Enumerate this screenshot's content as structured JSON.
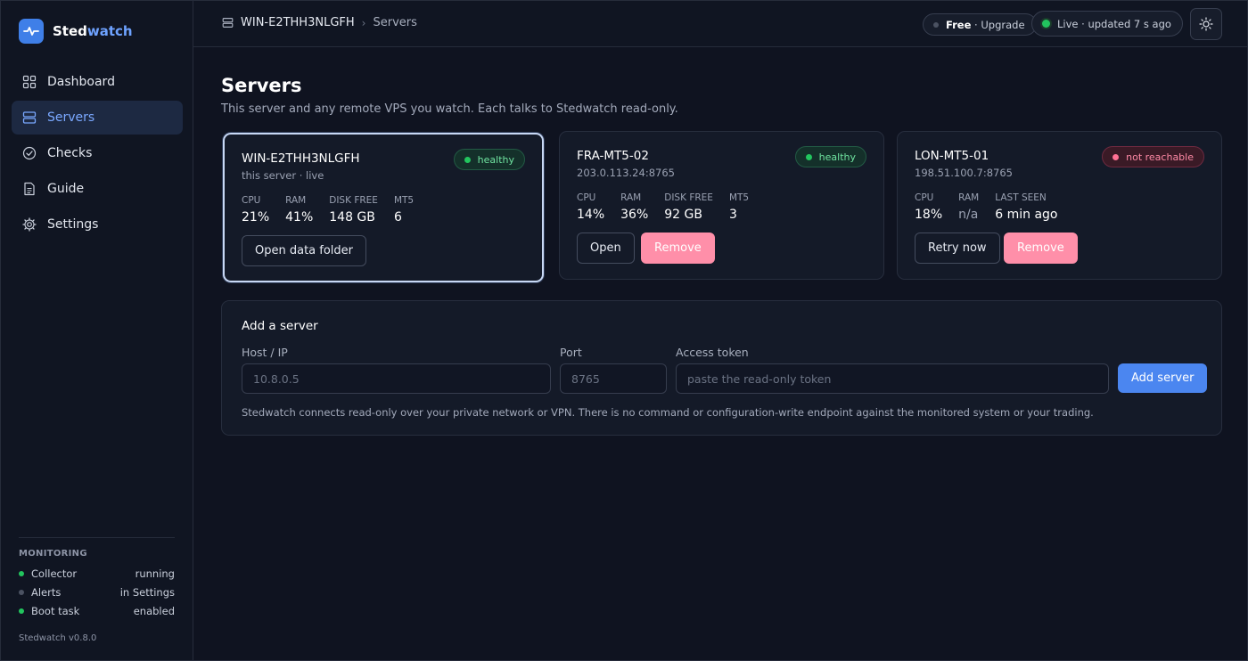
{
  "brand": {
    "name_part1": "Sted",
    "name_part2": "watch",
    "logo_icon": "pulse-icon"
  },
  "sidebar": {
    "nav": [
      {
        "label": "Dashboard",
        "icon": "grid-icon",
        "active": false
      },
      {
        "label": "Servers",
        "icon": "server-icon",
        "active": true
      },
      {
        "label": "Checks",
        "icon": "check-circle-icon",
        "active": false
      },
      {
        "label": "Guide",
        "icon": "document-icon",
        "active": false
      },
      {
        "label": "Settings",
        "icon": "gear-icon",
        "active": false
      }
    ],
    "monitoring": {
      "title": "MONITORING",
      "rows": [
        {
          "label": "Collector",
          "value": "running",
          "status": "green"
        },
        {
          "label": "Alerts",
          "value": "in Settings",
          "status": "gray"
        },
        {
          "label": "Boot task",
          "value": "enabled",
          "status": "green"
        }
      ]
    },
    "version": "Stedwatch v0.8.0"
  },
  "topbar": {
    "breadcrumb": {
      "host": "WIN-E2THH3NLGFH",
      "separator": "›",
      "page": "Servers"
    },
    "plan": {
      "tier": "Free",
      "separator": " · ",
      "action": "Upgrade"
    },
    "live": {
      "text": "Live · updated 7 s ago"
    },
    "theme_icon": "sun-icon"
  },
  "main": {
    "title": "Servers",
    "subtitle": "This server and any remote VPS you watch. Each talks to Stedwatch read-only."
  },
  "servers": [
    {
      "name": "WIN-E2THH3NLGFH",
      "sub": "this server · live",
      "status": "healthy",
      "metrics": [
        {
          "label": "CPU",
          "value": "21%"
        },
        {
          "label": "RAM",
          "value": "41%"
        },
        {
          "label": "DISK FREE",
          "value": "148 GB"
        },
        {
          "label": "MT5",
          "value": "6"
        }
      ],
      "actions": [
        "Open data folder"
      ]
    },
    {
      "name": "FRA-MT5-02",
      "sub": "203.0.113.24:8765",
      "status": "healthy",
      "metrics": [
        {
          "label": "CPU",
          "value": "14%"
        },
        {
          "label": "RAM",
          "value": "36%"
        },
        {
          "label": "DISK FREE",
          "value": "92 GB"
        },
        {
          "label": "MT5",
          "value": "3"
        }
      ],
      "actions": [
        "Open",
        "Remove"
      ]
    },
    {
      "name": "LON-MT5-01",
      "sub": "198.51.100.7:8765",
      "status": "not reachable",
      "metrics": [
        {
          "label": "CPU",
          "value": "18%"
        },
        {
          "label": "RAM",
          "value": "n/a"
        },
        {
          "label": "LAST SEEN",
          "value": "6 min ago"
        }
      ],
      "actions": [
        "Retry now",
        "Remove"
      ]
    }
  ],
  "add_server": {
    "title": "Add a server",
    "host_label": "Host / IP",
    "host_placeholder": "10.8.0.5",
    "port_label": "Port",
    "port_placeholder": "8765",
    "token_label": "Access token",
    "token_placeholder": "paste the read-only token",
    "submit_label": "Add server",
    "note": "Stedwatch connects read-only over your private network or VPN. There is no command or configuration-write endpoint against the monitored system or your trading."
  },
  "colors": {
    "accent": "#4b86f0",
    "healthy": "#22c55e",
    "danger": "#ff8fa9",
    "background": "#0f1320"
  }
}
